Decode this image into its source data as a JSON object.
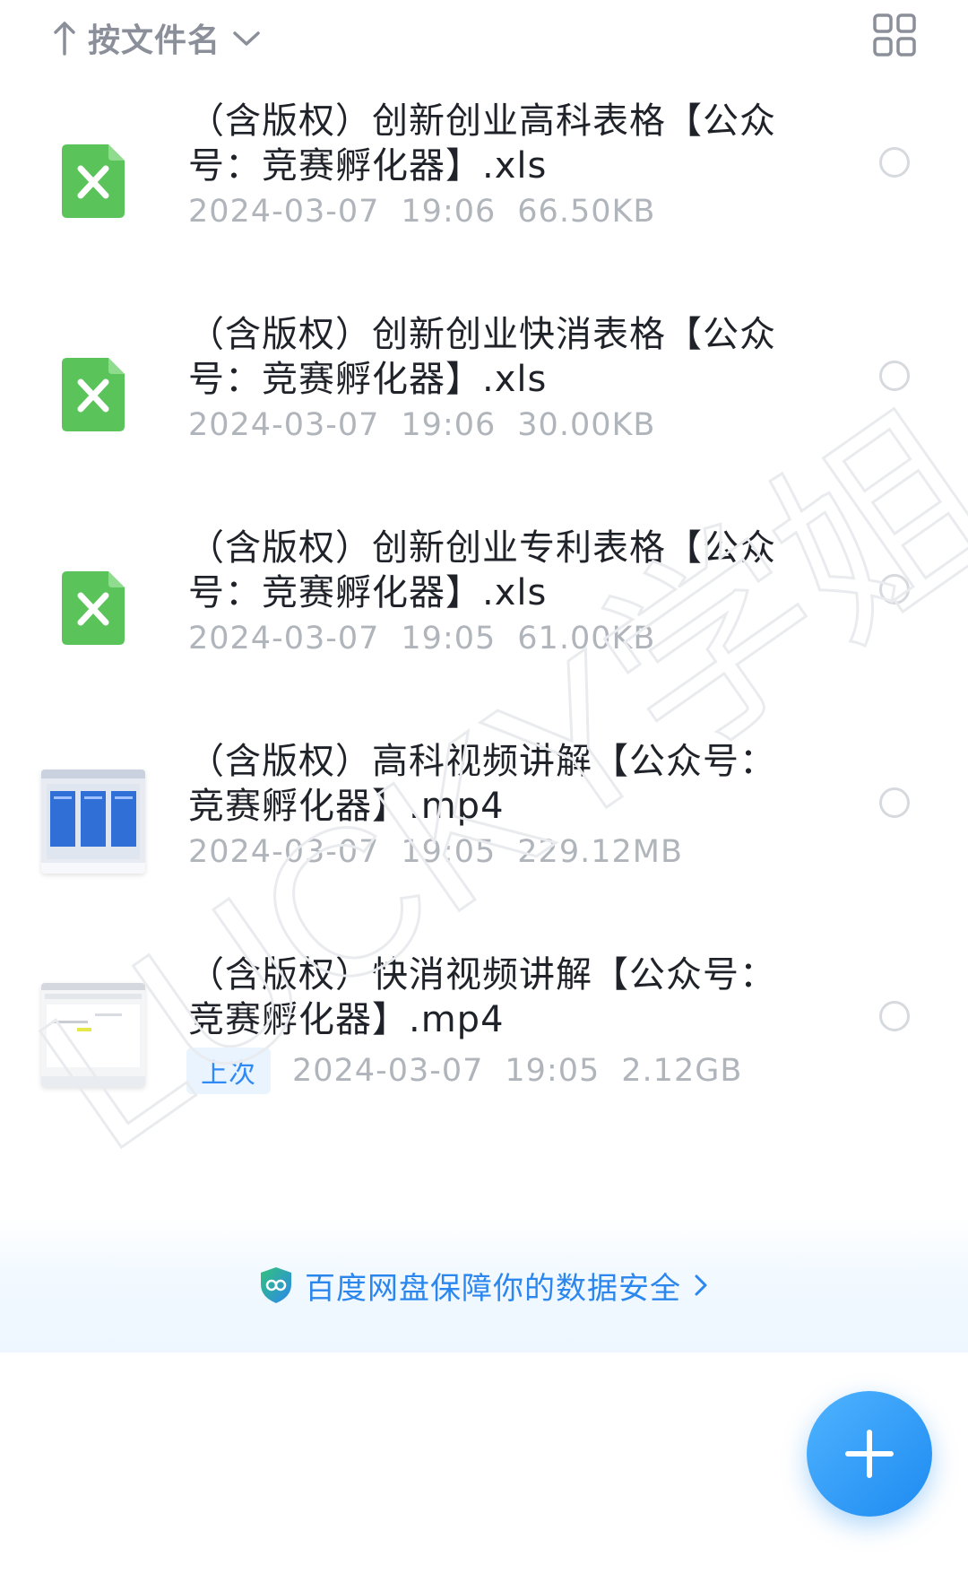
{
  "sort": {
    "label": "按文件名",
    "arrow_icon": "arrow-up-icon",
    "caret_icon": "chevron-down-icon",
    "view_toggle_icon": "grid-view-icon"
  },
  "files": [
    {
      "name": "（含版权）创新创业高科表格【公众号：竞赛孵化器】.xls",
      "name_line1": "（含版权）创新创业高科表格【公众",
      "name_line2": "号：竞赛孵化器】.xls",
      "date": "2024-03-07",
      "time": "19:06",
      "size": "66.50KB",
      "type_icon": "excel-file-icon",
      "badge": ""
    },
    {
      "name": "（含版权）创新创业快消表格【公众号：竞赛孵化器】.xls",
      "name_line1": "（含版权）创新创业快消表格【公众",
      "name_line2": "号：竞赛孵化器】.xls",
      "date": "2024-03-07",
      "time": "19:06",
      "size": "30.00KB",
      "type_icon": "excel-file-icon",
      "badge": ""
    },
    {
      "name": "（含版权）创新创业专利表格【公众号：竞赛孵化器】.xls",
      "name_line1": "（含版权）创新创业专利表格【公众",
      "name_line2": "号：竞赛孵化器】.xls",
      "date": "2024-03-07",
      "time": "19:05",
      "size": "61.00KB",
      "type_icon": "excel-file-icon",
      "badge": ""
    },
    {
      "name": "（含版权）高科视频讲解【公众号：竞赛孵化器】.mp4",
      "name_line1": "（含版权）高科视频讲解【公众号：",
      "name_line2": "竞赛孵化器】.mp4",
      "date": "2024-03-07",
      "time": "19:05",
      "size": "229.12MB",
      "type_icon": "video-thumbnail",
      "badge": ""
    },
    {
      "name": "（含版权）快消视频讲解【公众号：竞赛孵化器】.mp4",
      "name_line1": "（含版权）快消视频讲解【公众号：",
      "name_line2": "竞赛孵化器】.mp4",
      "date": "2024-03-07",
      "time": "19:05",
      "size": "2.12GB",
      "type_icon": "video-thumbnail",
      "badge": "上次"
    }
  ],
  "security_banner": {
    "text": "百度网盘保障你的数据安全",
    "icon": "shield-icon",
    "chevron_icon": "chevron-right-icon"
  },
  "fab": {
    "icon": "plus-icon"
  },
  "watermark": {
    "text": "LUCKY学姐"
  },
  "colors": {
    "accent": "#2b87ee",
    "excel_green": "#5ac35a",
    "text_primary": "#1f2329",
    "text_secondary": "#b0b4bb"
  }
}
